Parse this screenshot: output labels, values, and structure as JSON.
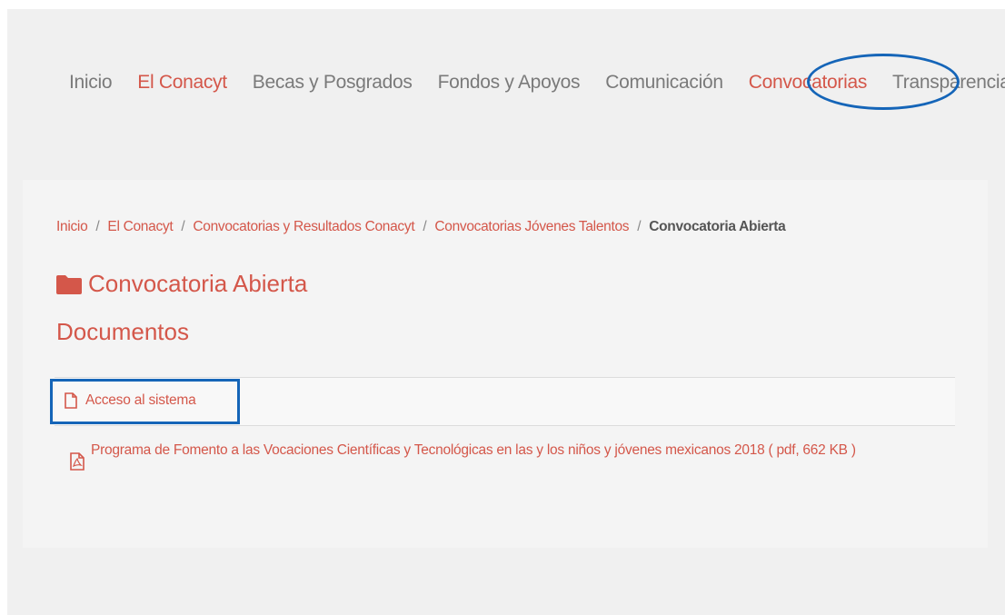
{
  "nav": {
    "items": [
      {
        "label": "Inicio"
      },
      {
        "label": "El Conacyt"
      },
      {
        "label": "Becas y Posgrados"
      },
      {
        "label": "Fondos y Apoyos"
      },
      {
        "label": "Comunicación"
      },
      {
        "label": "Convocatorias"
      },
      {
        "label": "Transparencia"
      }
    ]
  },
  "breadcrumb": {
    "items": [
      "Inicio",
      "El Conacyt",
      "Convocatorias y Resultados Conacyt",
      "Convocatorias Jóvenes Talentos"
    ],
    "separator": "/",
    "current": "Convocatoria Abierta"
  },
  "page": {
    "title": "Convocatoria Abierta",
    "section": "Documentos"
  },
  "documents": [
    {
      "label": "Acceso al sistema",
      "icon": "file-icon"
    },
    {
      "label": "Programa de Fomento a las Vocaciones Científicas y Tecnológicas en las y los niños y jóvenes mexicanos 2018 ( pdf, 662 KB )",
      "icon": "file-pdf-icon"
    }
  ],
  "colors": {
    "accent": "#d4574a",
    "annotation": "#1565b8",
    "nav_text": "#7a7a7a"
  }
}
